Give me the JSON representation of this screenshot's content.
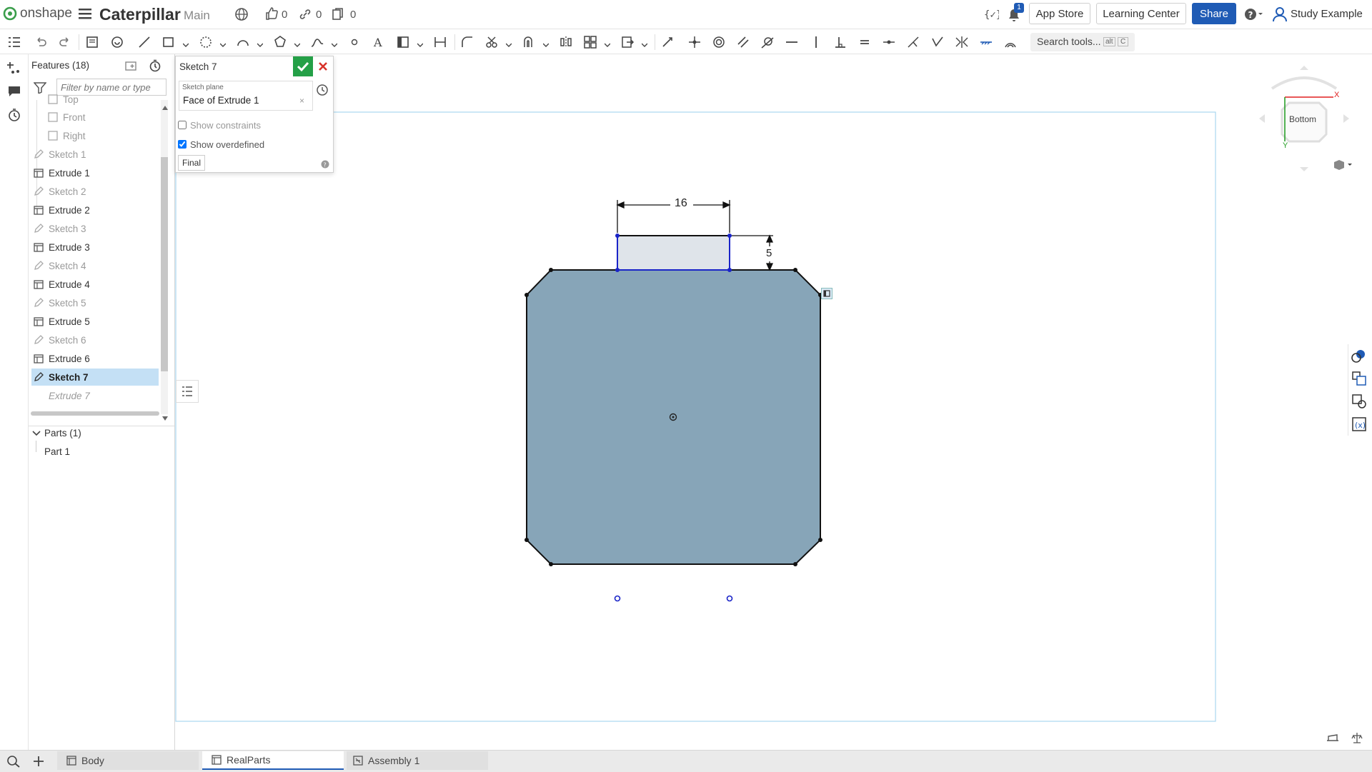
{
  "app": {
    "logo_text": "onshape",
    "document_title": "Caterpillar",
    "workspace": "Main",
    "likes_count": "0",
    "links_count": "0",
    "copies_count": "0",
    "notifications_badge": "1",
    "app_store_label": "App Store",
    "learning_center_label": "Learning Center",
    "share_label": "Share",
    "user_name": "Study Example",
    "search_tools_label": "Search tools...",
    "search_shortcut_alt": "alt",
    "search_shortcut_key": "C"
  },
  "features": {
    "header": "Features (18)",
    "filter_placeholder": "Filter by name or type",
    "items": [
      {
        "label": "Top",
        "type": "plane"
      },
      {
        "label": "Front",
        "type": "plane"
      },
      {
        "label": "Right",
        "type": "plane"
      },
      {
        "label": "Sketch 1",
        "type": "sketch"
      },
      {
        "label": "Extrude 1",
        "type": "extrude"
      },
      {
        "label": "Sketch 2",
        "type": "sketch"
      },
      {
        "label": "Extrude 2",
        "type": "extrude"
      },
      {
        "label": "Sketch 3",
        "type": "sketch"
      },
      {
        "label": "Extrude 3",
        "type": "extrude"
      },
      {
        "label": "Sketch 4",
        "type": "sketch"
      },
      {
        "label": "Extrude 4",
        "type": "extrude"
      },
      {
        "label": "Sketch 5",
        "type": "sketch"
      },
      {
        "label": "Extrude 5",
        "type": "extrude"
      },
      {
        "label": "Sketch 6",
        "type": "sketch"
      },
      {
        "label": "Extrude 6",
        "type": "extrude"
      },
      {
        "label": "Sketch 7",
        "type": "sketch",
        "selected": true
      },
      {
        "label": "Extrude 7",
        "type": "extrude",
        "suppressed": true
      }
    ],
    "parts_header": "Parts (1)",
    "parts": [
      "Part 1"
    ]
  },
  "sketch_dialog": {
    "title": "Sketch 7",
    "plane_label": "Sketch plane",
    "plane_value": "Face of Extrude 1",
    "show_constraints_label": "Show constraints",
    "show_constraints_checked": false,
    "show_overdefined_label": "Show overdefined",
    "show_overdefined_checked": true,
    "final_label": "Final"
  },
  "viewport": {
    "dimension_width": "16",
    "dimension_height": "5",
    "view_cube_label": "Bottom",
    "axis_x": "X",
    "axis_y": "Y",
    "part_color": "#87a5b8",
    "sketch_region_color": "#dfe4ea",
    "selection_color": "#1a24c8"
  },
  "tabs": [
    {
      "label": "Body",
      "active": false
    },
    {
      "label": "RealParts",
      "active": true
    },
    {
      "label": "Assembly 1",
      "active": false
    }
  ]
}
